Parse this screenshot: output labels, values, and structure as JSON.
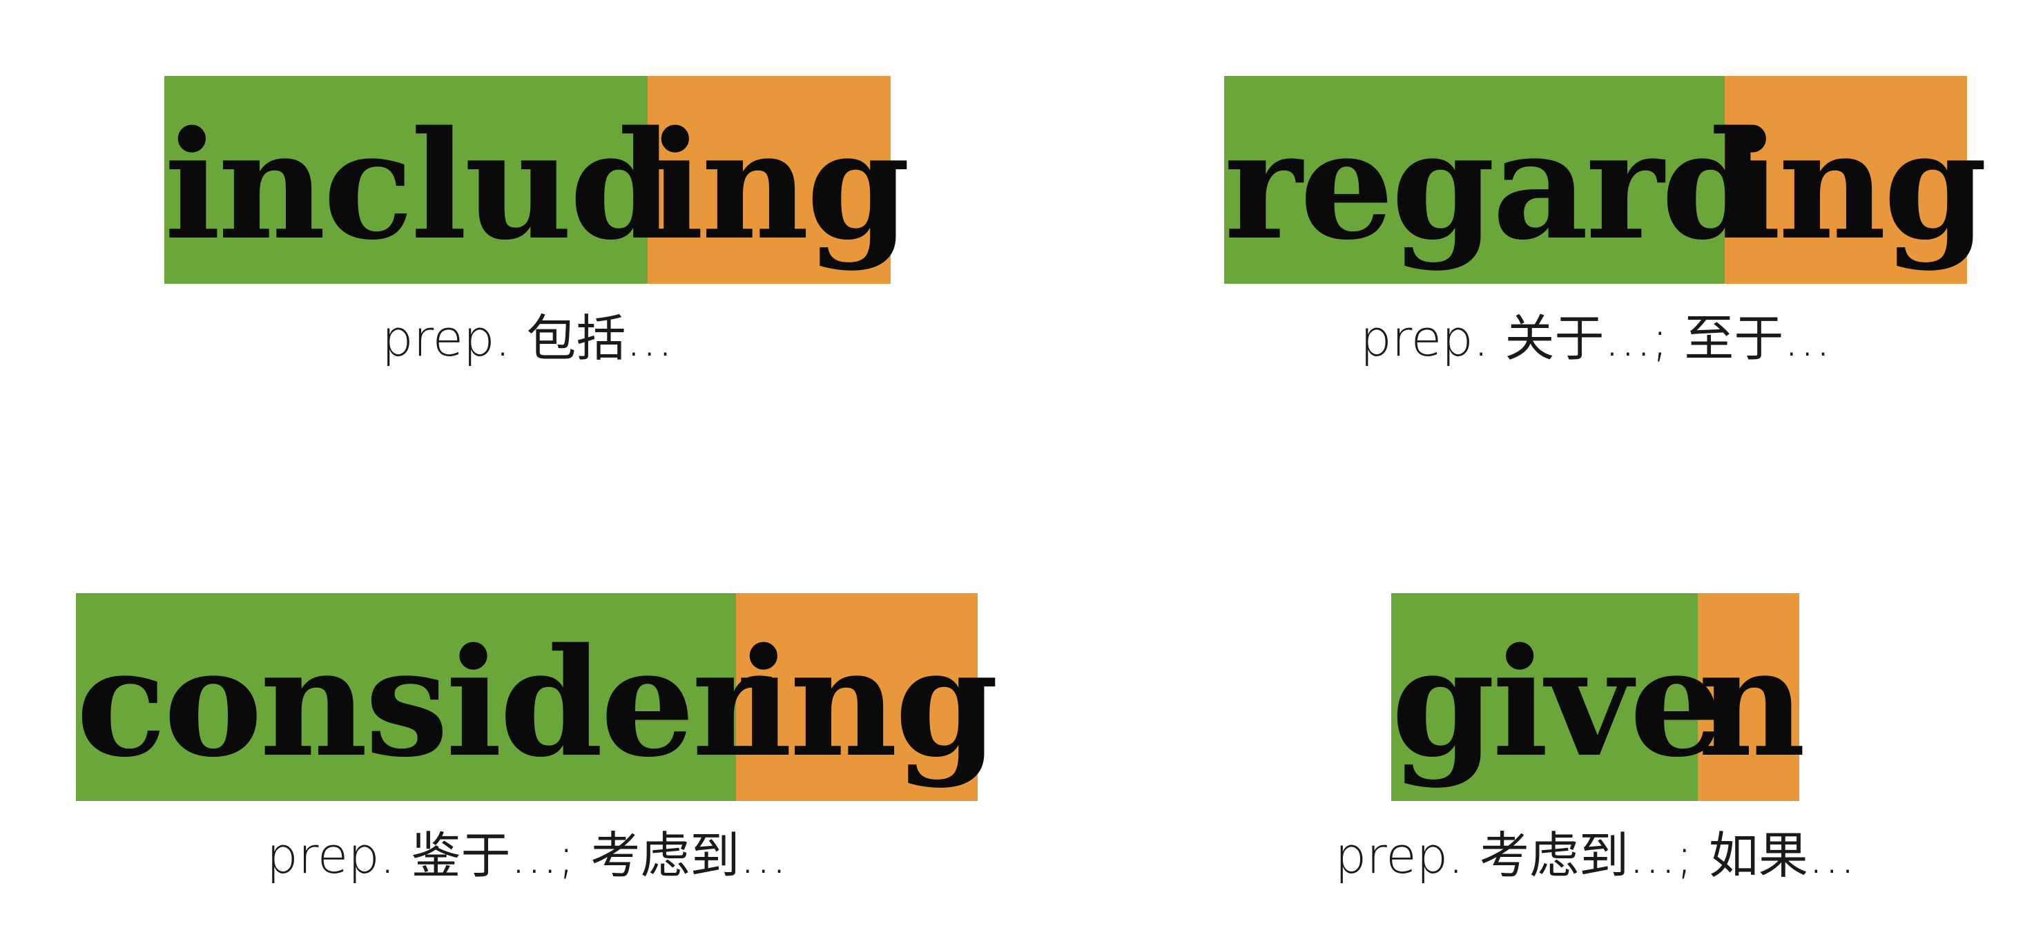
{
  "colors": {
    "stem_background": "#6aa639",
    "suffix_background": "#e8973a",
    "text": "#0a0a0a"
  },
  "cards": [
    {
      "stem": "includ",
      "suffix": "ing",
      "gloss": "prep. 包括..."
    },
    {
      "stem": "regard",
      "suffix": "ing",
      "gloss": "prep. 关于...; 至于..."
    },
    {
      "stem": "consider",
      "suffix": "ing",
      "gloss": "prep. 鉴于...; 考虑到..."
    },
    {
      "stem": "give",
      "suffix": "n",
      "gloss": "prep. 考虑到...; 如果..."
    }
  ]
}
